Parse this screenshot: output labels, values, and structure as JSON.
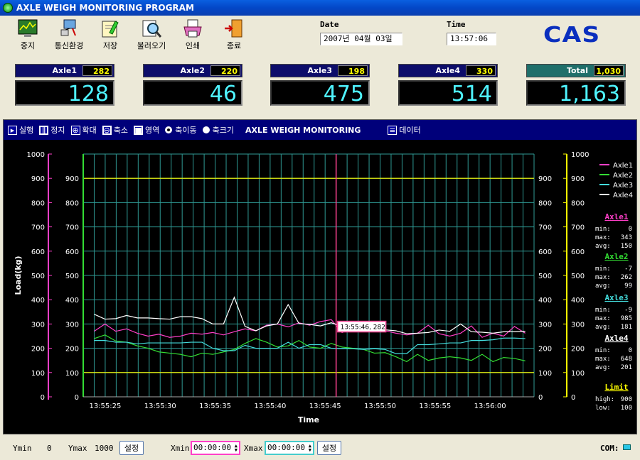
{
  "app": {
    "title": "AXLE WEIGH MONITORING PROGRAM"
  },
  "toolbar": {
    "stop": "중지",
    "comm": "통신환경",
    "save": "저장",
    "load": "불러오기",
    "print": "인쇄",
    "exit": "종료"
  },
  "datetime": {
    "date_label": "Date",
    "date": "2007년 04월 03일",
    "time_label": "Time",
    "time": "13:57:06"
  },
  "brand": "CAS",
  "axles": [
    {
      "name": "Axle1",
      "small": "282",
      "big": "128"
    },
    {
      "name": "Axle2",
      "small": "220",
      "big": "46"
    },
    {
      "name": "Axle3",
      "small": "198",
      "big": "475"
    },
    {
      "name": "Axle4",
      "small": "330",
      "big": "514"
    }
  ],
  "total": {
    "name": "Total",
    "small": "1,030",
    "big": "1,163"
  },
  "chart_toolbar": {
    "run": "실행",
    "pause": "정지",
    "zoom_in": "확대",
    "zoom_out": "축소",
    "area": "영역",
    "axis_move": "축이동",
    "axis_size": "축크기",
    "title": "AXLE WEIGH MONITORING",
    "data": "데이터"
  },
  "colors": {
    "axle1": "#ff3fc8",
    "axle2": "#33dd33",
    "axle3": "#44dddd",
    "axle4": "#ffffff",
    "limit": "#ffff00",
    "cursor": "#ff3f8f",
    "grid": "#2f9a94"
  },
  "chart_data": {
    "type": "line",
    "ylabel": "Load(kg)",
    "xlabel": "Time",
    "ylim": [
      0,
      1000
    ],
    "xlim": [
      "13:55:23",
      "13:56:04"
    ],
    "yticks": [
      0,
      100,
      200,
      300,
      400,
      500,
      600,
      700,
      800,
      900,
      1000
    ],
    "xticks": [
      "13:55:25",
      "13:55:30",
      "13:55:35",
      "13:55:40",
      "13:55:45",
      "13:55:50",
      "13:55:55",
      "13:56:00"
    ],
    "limits": {
      "high": 900,
      "low": 100
    },
    "cursor": {
      "x": "13:55:46",
      "label": "13:55:46, 282"
    },
    "series": [
      {
        "name": "Axle1",
        "color": "#ff3fc8",
        "x": [
          0,
          1,
          2,
          3,
          4,
          5,
          6,
          7,
          8,
          9,
          10,
          11,
          12,
          13,
          14,
          15,
          16,
          17,
          18,
          19,
          20,
          21,
          22,
          23,
          24,
          25,
          26,
          27,
          28,
          29,
          30,
          31,
          32,
          33,
          34,
          35,
          36,
          37,
          38,
          39,
          40
        ],
        "y": [
          270,
          300,
          270,
          280,
          262,
          250,
          258,
          245,
          250,
          262,
          258,
          265,
          255,
          268,
          280,
          272,
          295,
          300,
          288,
          305,
          295,
          310,
          318,
          265,
          282,
          280,
          270,
          272,
          262,
          255,
          262,
          295,
          260,
          250,
          262,
          292,
          245,
          262,
          250,
          290,
          262
        ]
      },
      {
        "name": "Axle2",
        "color": "#33dd33",
        "x": [
          0,
          1,
          2,
          3,
          4,
          5,
          6,
          7,
          8,
          9,
          10,
          11,
          12,
          13,
          14,
          15,
          16,
          17,
          18,
          19,
          20,
          21,
          22,
          23,
          24,
          25,
          26,
          27,
          28,
          29,
          30,
          31,
          32,
          33,
          34,
          35,
          36,
          37,
          38,
          39,
          40
        ],
        "y": [
          240,
          255,
          230,
          225,
          210,
          200,
          185,
          180,
          175,
          165,
          180,
          175,
          185,
          195,
          220,
          240,
          225,
          205,
          210,
          232,
          205,
          200,
          220,
          205,
          200,
          195,
          180,
          182,
          165,
          145,
          175,
          150,
          160,
          165,
          160,
          150,
          175,
          145,
          162,
          158,
          148
        ]
      },
      {
        "name": "Axle3",
        "color": "#44dddd",
        "x": [
          0,
          1,
          2,
          3,
          4,
          5,
          6,
          7,
          8,
          9,
          10,
          11,
          12,
          13,
          14,
          15,
          16,
          17,
          18,
          19,
          20,
          21,
          22,
          23,
          24,
          25,
          26,
          27,
          28,
          29,
          30,
          31,
          32,
          33,
          34,
          35,
          36,
          37,
          38,
          39,
          40
        ],
        "y": [
          232,
          232,
          225,
          225,
          218,
          222,
          222,
          222,
          222,
          225,
          225,
          200,
          190,
          190,
          212,
          200,
          200,
          200,
          225,
          200,
          215,
          215,
          200,
          198,
          198,
          195,
          198,
          195,
          178,
          178,
          215,
          215,
          218,
          222,
          222,
          232,
          232,
          235,
          242,
          242,
          240
        ]
      },
      {
        "name": "Axle4",
        "color": "#ffffff",
        "x": [
          0,
          1,
          2,
          3,
          4,
          5,
          6,
          7,
          8,
          9,
          10,
          11,
          12,
          13,
          14,
          15,
          16,
          17,
          18,
          19,
          20,
          21,
          22,
          23,
          24,
          25,
          26,
          27,
          28,
          29,
          30,
          31,
          32,
          33,
          34,
          35,
          36,
          37,
          38,
          39,
          40
        ],
        "y": [
          340,
          320,
          322,
          335,
          325,
          325,
          322,
          320,
          330,
          330,
          322,
          300,
          300,
          410,
          290,
          272,
          292,
          300,
          380,
          302,
          298,
          292,
          305,
          290,
          276,
          276,
          270,
          276,
          272,
          260,
          262,
          265,
          275,
          270,
          300,
          268,
          266,
          262,
          268,
          268,
          270
        ]
      }
    ]
  },
  "legend": [
    "Axle1",
    "Axle2",
    "Axle3",
    "Axle4"
  ],
  "stats": [
    {
      "title": "Axle1",
      "min_label": "min:",
      "min": "0",
      "max_label": "max:",
      "max": "343",
      "avg_label": "avg:",
      "avg": "150"
    },
    {
      "title": "Axle2",
      "min_label": "min:",
      "min": "-7",
      "max_label": "max:",
      "max": "262",
      "avg_label": "avg:",
      "avg": "99"
    },
    {
      "title": "Axle3",
      "min_label": "min:",
      "min": "-9",
      "max_label": "max:",
      "max": "985",
      "avg_label": "avg:",
      "avg": "181"
    },
    {
      "title": "Axle4",
      "min_label": "min:",
      "min": "0",
      "max_label": "max:",
      "max": "648",
      "avg_label": "avg:",
      "avg": "201"
    }
  ],
  "limit_box": {
    "title": "Limit",
    "high_label": "high:",
    "high": "900",
    "low_label": "low:",
    "low": "100"
  },
  "bottom": {
    "ymin_label": "Ymin",
    "ymin": "0",
    "ymax_label": "Ymax",
    "ymax": "1000",
    "set1": "설정",
    "xmin_label": "Xmin",
    "xmin": "00:00:00",
    "xmax_label": "Xmax",
    "xmax": "00:00:00",
    "set2": "설정",
    "com_label": "COM:"
  }
}
